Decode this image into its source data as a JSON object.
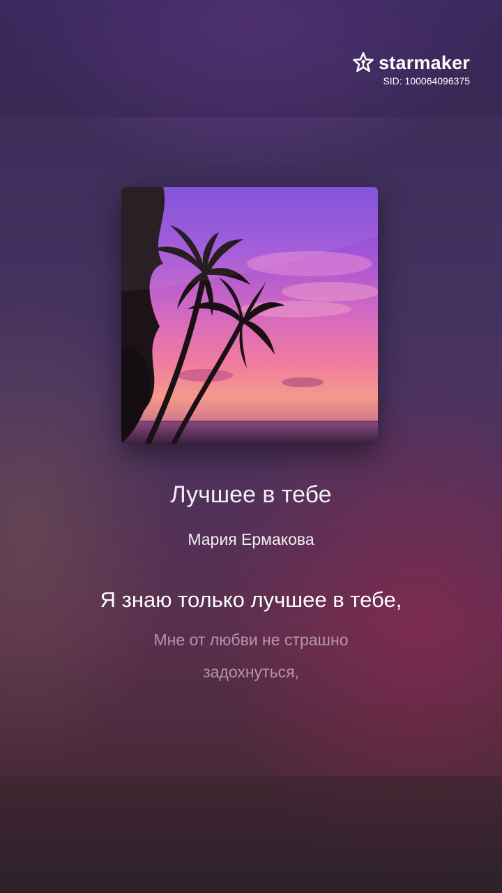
{
  "brand": {
    "name": "starmaker",
    "logo_icon": "star-logo-icon",
    "sid": "SID: 100064096375"
  },
  "song": {
    "cover_icon": "palm-sunset-cover",
    "title": "Лучшее в тебе",
    "artist": "Мария Ермакова"
  },
  "lyrics": {
    "current": "Я знаю только лучшее в тебе,",
    "next_line_1": "Мне от любви не страшно",
    "next_line_2": "задохнуться,"
  },
  "colors": {
    "background": "#3f2f5c",
    "text_primary": "#ffffff",
    "text_dim": "#b8a4b4"
  }
}
